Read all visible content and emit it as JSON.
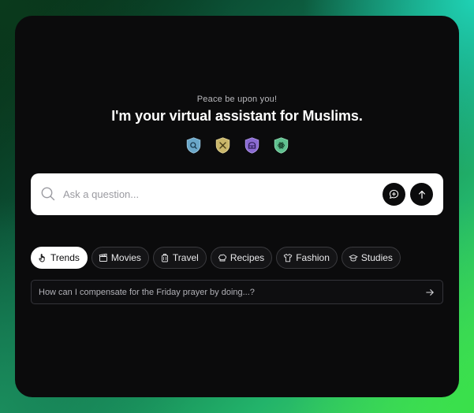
{
  "header": {
    "greeting": "Peace be upon you!",
    "title": "I'm your virtual assistant for Muslims."
  },
  "badges": [
    {
      "icon": "search-shield-icon",
      "color": "#6aa7c9"
    },
    {
      "icon": "tools-shield-icon",
      "color": "#c9b66a"
    },
    {
      "icon": "mosque-shield-icon",
      "color": "#8a6ad1"
    },
    {
      "icon": "atom-shield-icon",
      "color": "#5fc08f"
    }
  ],
  "search": {
    "placeholder": "Ask a question..."
  },
  "chips": [
    {
      "label": "Trends",
      "icon": "hand-pointer-icon",
      "active": true
    },
    {
      "label": "Movies",
      "icon": "clapperboard-icon",
      "active": false
    },
    {
      "label": "Travel",
      "icon": "luggage-icon",
      "active": false
    },
    {
      "label": "Recipes",
      "icon": "chef-hat-icon",
      "active": false
    },
    {
      "label": "Fashion",
      "icon": "shirt-icon",
      "active": false
    },
    {
      "label": "Studies",
      "icon": "graduation-cap-icon",
      "active": false
    }
  ],
  "suggestion": {
    "text": "How can I compensate for the Friday prayer by doing...?"
  }
}
